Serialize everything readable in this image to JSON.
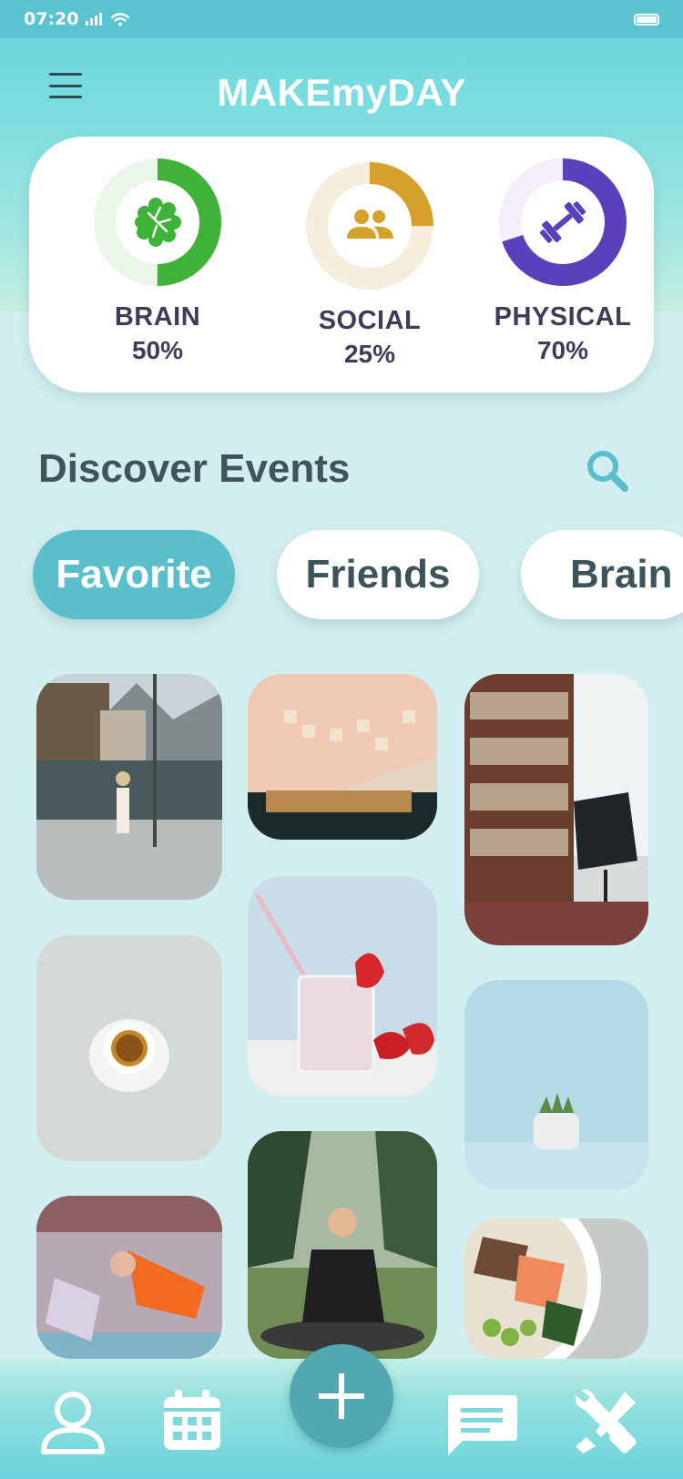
{
  "status_bar": {
    "time": "07:20",
    "icons": [
      "signal-icon",
      "wifi-icon",
      "battery-icon"
    ]
  },
  "app": {
    "title": "MAKEmyDAY",
    "menu_icon": "hamburger-menu-icon"
  },
  "stats": [
    {
      "label": "BRAIN",
      "percent_text": "50%",
      "progress": 0.5,
      "color": "#3fb23a",
      "track": "#eaf6e8",
      "icon": "brain-icon"
    },
    {
      "label": "SOCIAL",
      "percent_text": "25%",
      "progress": 0.25,
      "color": "#d6a12a",
      "track": "#f6eedd",
      "icon": "people-icon"
    },
    {
      "label": "PHYSICAL",
      "percent_text": "70%",
      "progress": 0.7,
      "color": "#5a41bb",
      "track": "#f3eefa",
      "icon": "dumbbell-icon"
    }
  ],
  "discover": {
    "title": "Discover Events",
    "search_icon": "search-icon"
  },
  "filters": [
    {
      "label": "Favorite",
      "active": true
    },
    {
      "label": "Friends",
      "active": false
    },
    {
      "label": "Brain",
      "active": false
    }
  ],
  "events": [
    "lakeside-town-photo",
    "scrabble-board-photo",
    "library-armchair-photo",
    "espresso-cup-photo",
    "strawberry-milkshake-photo",
    "potted-succulent-photo",
    "group-yoga-class-photo",
    "outdoor-meditation-photo",
    "salmon-poke-bowl-photo"
  ],
  "bottom_nav": {
    "items": [
      "profile-icon",
      "calendar-icon",
      "add-icon",
      "chat-icon",
      "tools-icon"
    ]
  },
  "colors": {
    "accent": "#5abfca",
    "fab": "#52a8b1",
    "heading": "#3f555d",
    "background": "#d3eef0"
  }
}
